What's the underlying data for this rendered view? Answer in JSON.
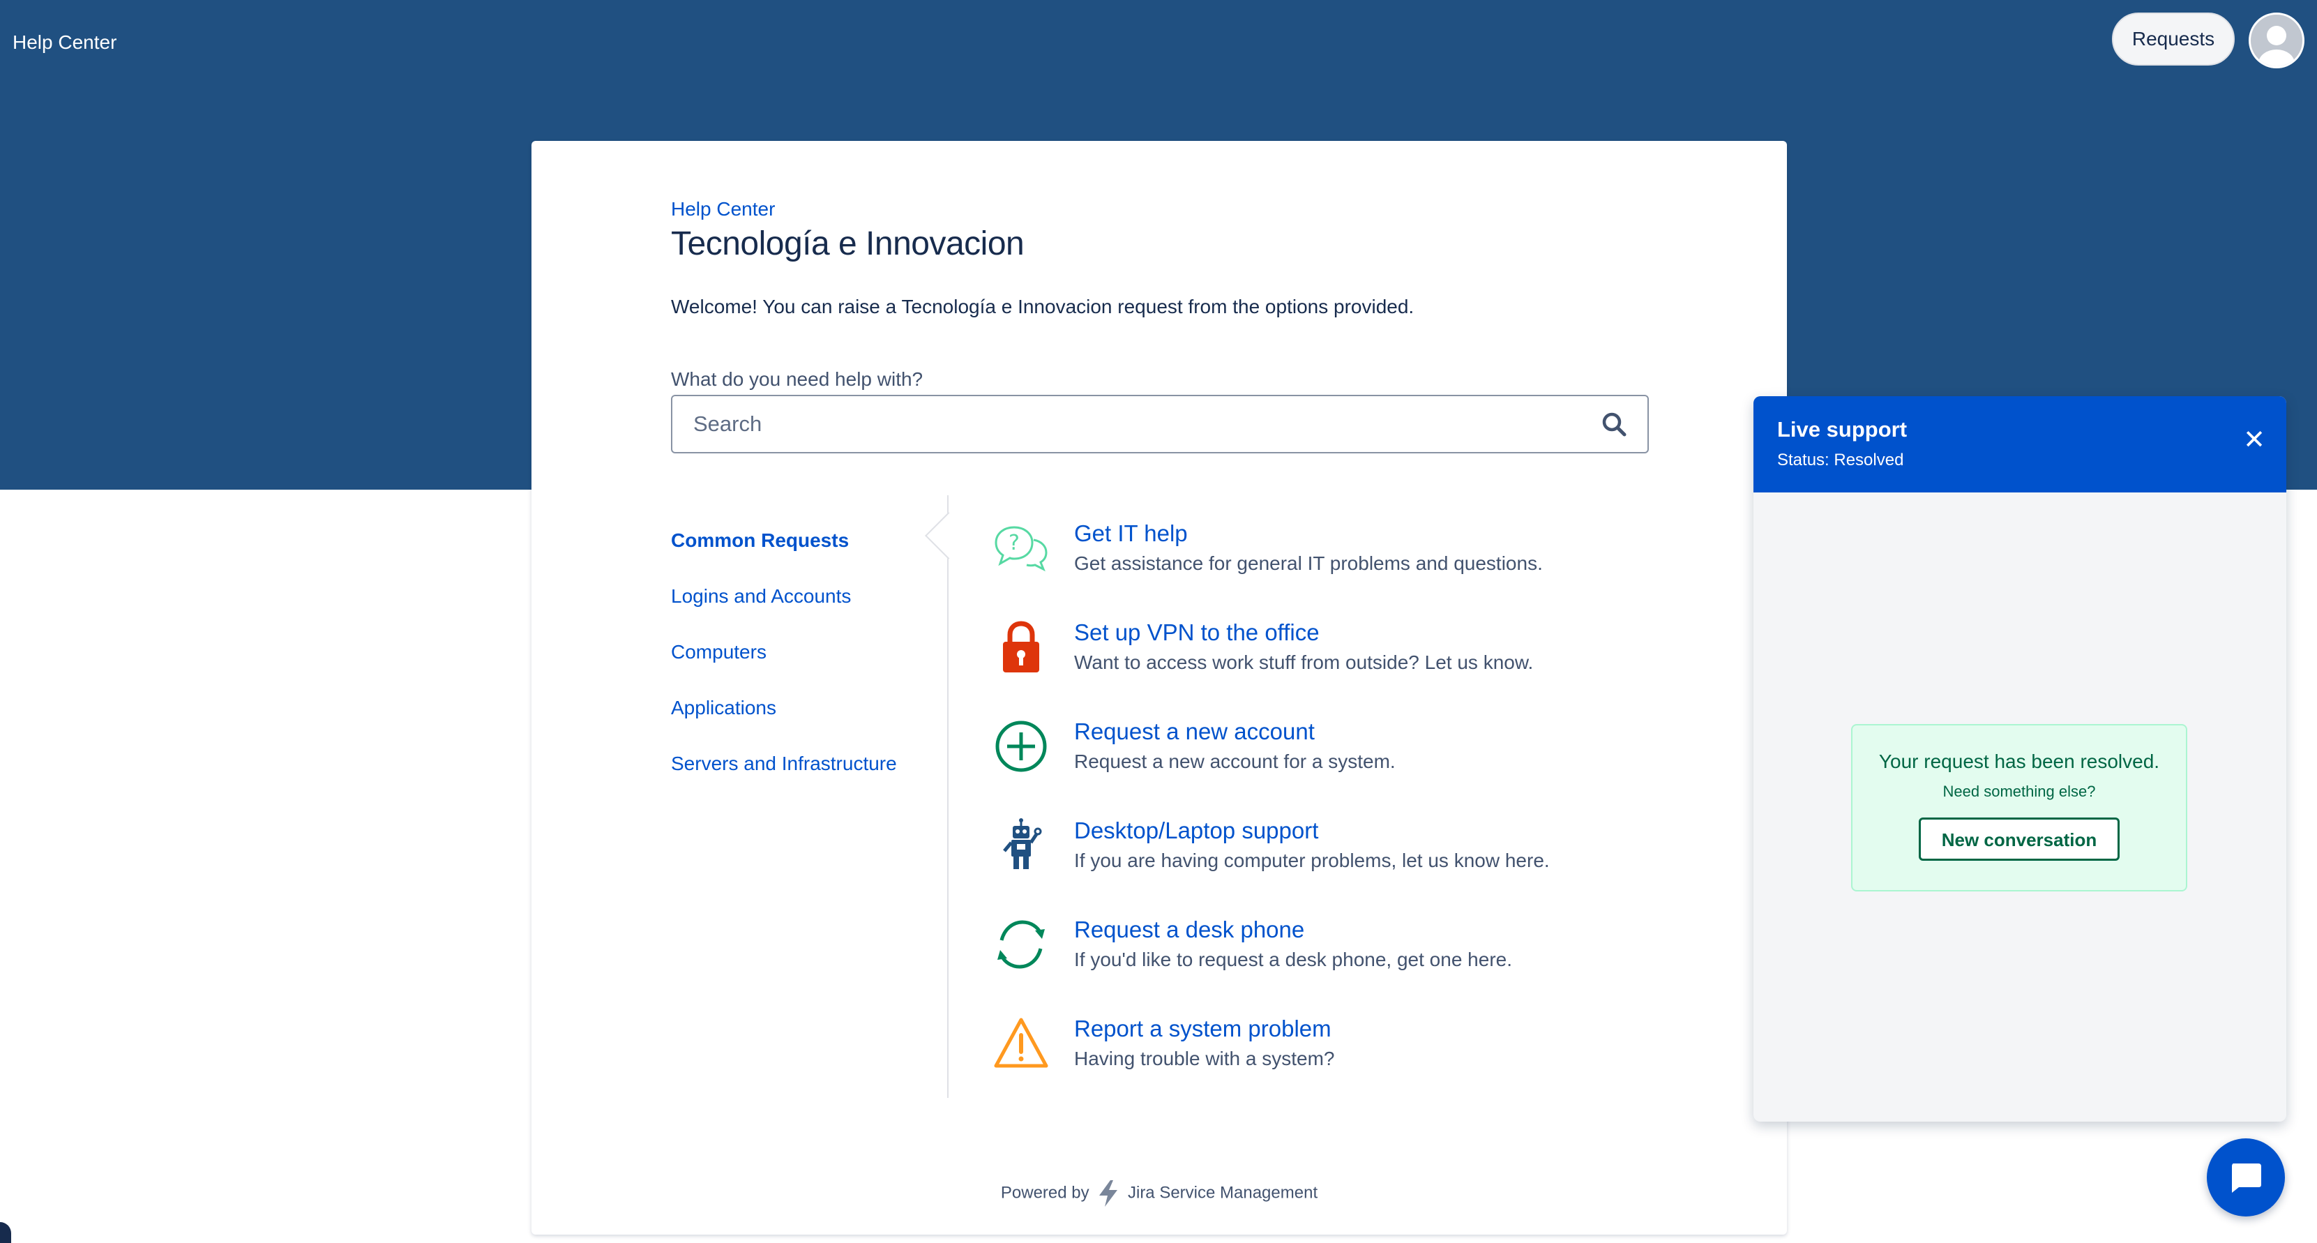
{
  "header": {
    "site_title": "Help Center",
    "requests_label": "Requests"
  },
  "portal": {
    "breadcrumb": "Help Center",
    "title": "Tecnología e Innovacion",
    "welcome": "Welcome! You can raise a Tecnología e Innovacion request from the options provided.",
    "search_label": "What do you need help with?",
    "search_placeholder": "Search"
  },
  "categories": [
    {
      "label": "Common Requests",
      "active": true
    },
    {
      "label": "Logins and Accounts",
      "active": false
    },
    {
      "label": "Computers",
      "active": false
    },
    {
      "label": "Applications",
      "active": false
    },
    {
      "label": "Servers and Infrastructure",
      "active": false
    }
  ],
  "request_types": [
    {
      "name": "Get IT help",
      "description": "Get assistance for general IT problems and questions.",
      "icon": "question-bubbles-icon"
    },
    {
      "name": "Set up VPN to the office",
      "description": "Want to access work stuff from outside? Let us know.",
      "icon": "lock-icon"
    },
    {
      "name": "Request a new account",
      "description": "Request a new account for a system.",
      "icon": "plus-circle-icon"
    },
    {
      "name": "Desktop/Laptop support",
      "description": "If you are having computer problems, let us know here.",
      "icon": "robot-icon"
    },
    {
      "name": "Request a desk phone",
      "description": "If you'd like to request a desk phone, get one here.",
      "icon": "refresh-arrows-icon"
    },
    {
      "name": "Report a system problem",
      "description": "Having trouble with a system?",
      "icon": "warning-icon"
    }
  ],
  "footer": {
    "powered_by": "Powered by",
    "product": "Jira Service Management"
  },
  "chat": {
    "title": "Live support",
    "status": "Status: Resolved",
    "resolved_message": "Your request has been resolved.",
    "need_else": "Need something else?",
    "new_conversation_label": "New conversation"
  },
  "colors": {
    "header_bg": "#205081",
    "link": "#0052cc",
    "chat_header": "#0052cc",
    "resolved_bg": "#e3fcef",
    "resolved_text": "#006644"
  }
}
